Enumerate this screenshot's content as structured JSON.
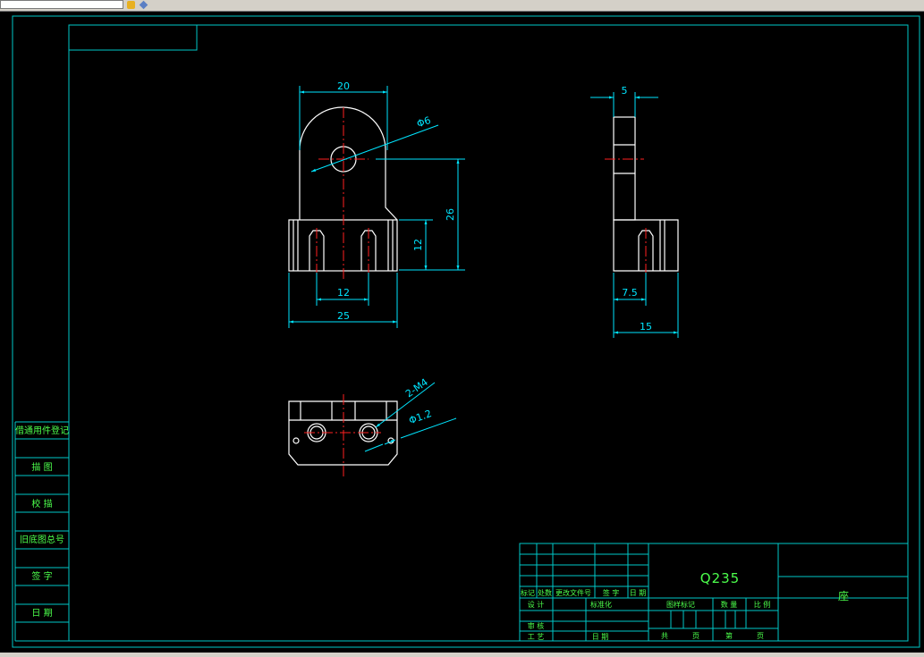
{
  "toolbar": {
    "icons": [
      "snap-icon",
      "view-icon"
    ]
  },
  "drawing": {
    "dims": {
      "front_width_top": "20",
      "hole_dia": "Φ6",
      "height_total": "26",
      "height_base": "12",
      "slot_spacing": "12",
      "front_width_base": "25",
      "side_thickness": "5",
      "side_half": "7.5",
      "side_width": "15",
      "thread_note": "2-M4",
      "small_hole": "Φ1.2"
    }
  },
  "left_strip": [
    "借通用件登记",
    "描 图",
    "校 描",
    "旧底图总号",
    "签 字",
    "日 期"
  ],
  "title_block": {
    "material": "Q235",
    "part_name": "座",
    "rev_headers": [
      "标记",
      "处数",
      "更改文件号",
      "签 字",
      "日 期"
    ],
    "roles": [
      "设 计",
      "标准化",
      "审 核",
      "工 艺",
      "日 期"
    ],
    "attr_headers": [
      "图样标记",
      "数 量",
      "比 例"
    ],
    "sheet_labels": [
      "共",
      "页",
      "第",
      "页"
    ]
  },
  "colors": {
    "line": "#ffffff",
    "dim": "#00e5ff",
    "center": "#ff2020",
    "frame": "#00c8c8",
    "text": "#4cff4c"
  }
}
